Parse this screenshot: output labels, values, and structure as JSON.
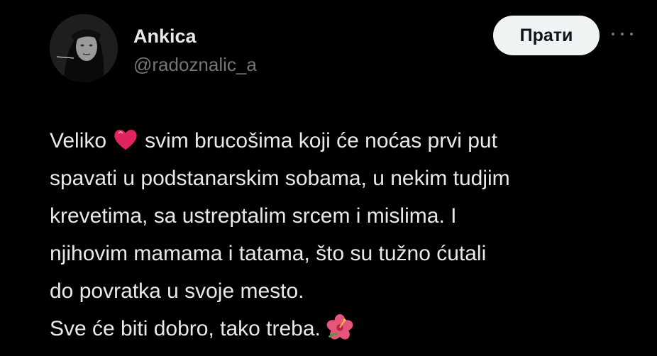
{
  "author": {
    "display_name": "Ankica",
    "handle": "@radoznalic_a",
    "avatar": "avatar-photo"
  },
  "actions": {
    "follow_label": "Прати",
    "more_icon": "more-horizontal-icon"
  },
  "tweet": {
    "line1_before": "Veliko",
    "line1_after": "svim brucošima koji će noćas prvi put",
    "line2": "spavati u podstanarskim sobama, u nekim tudjim",
    "line3": "krevetima, sa ustreptalim srcem i mislima. I",
    "line4": "njihovim mamama i tatama, što su tužno ćutali",
    "line5": "do povratka u svoje mesto.",
    "line6": "Sve će biti dobro, tako treba.",
    "emoji_1": "red-heart-emoji",
    "emoji_2": "hibiscus-emoji"
  },
  "colors": {
    "background": "#000000",
    "text_primary": "#e7e9ea",
    "text_secondary": "#71767b",
    "button_bg": "#eff3f4",
    "button_text": "#0f1419",
    "heart": "#e0245e",
    "hibiscus": "#e8557a"
  }
}
